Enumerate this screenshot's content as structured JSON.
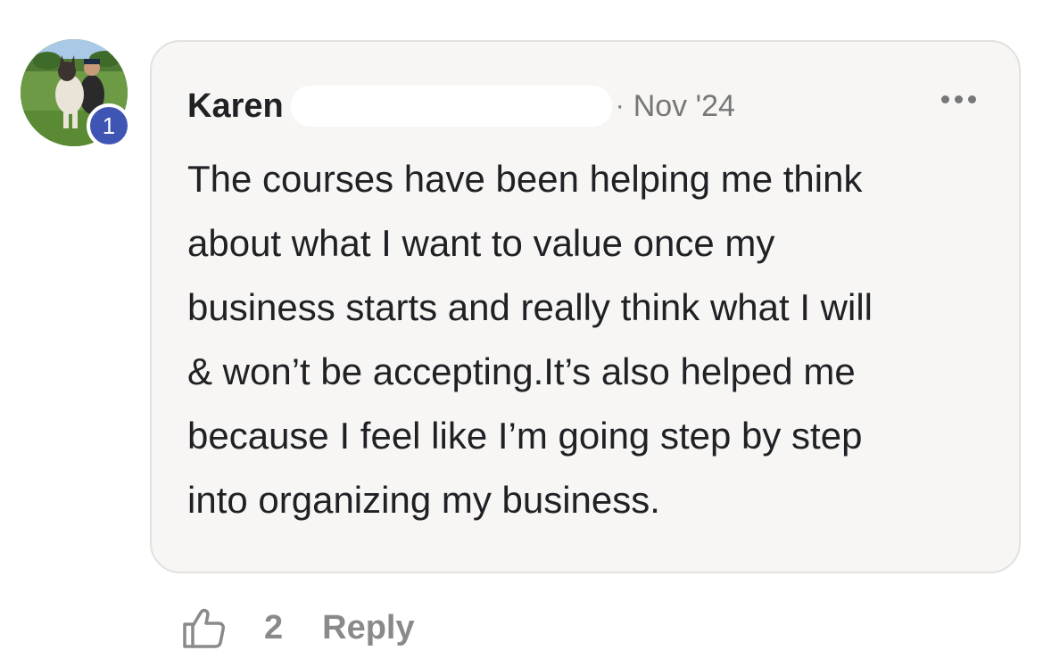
{
  "comment": {
    "author": "Karen",
    "separator": "·",
    "date": "Nov '24",
    "level": "1",
    "text": "The courses have been helping me think\nabout what I want to value once my\nbusiness starts and really think what I will\n& won’t be accepting.It’s also helped me\nbecause I feel like I’m going step by step\ninto organizing my business.",
    "like_count": "2",
    "reply_label": "Reply"
  },
  "icons": {
    "more": "more-horizontal-icon",
    "like": "thumbs-up-icon"
  },
  "colors": {
    "bubble_background": "#f7f6f4",
    "bubble_border": "#e2e1de",
    "level_badge": "#3f55b3",
    "muted_text": "#8a8a8a",
    "primary_text": "#202124"
  }
}
